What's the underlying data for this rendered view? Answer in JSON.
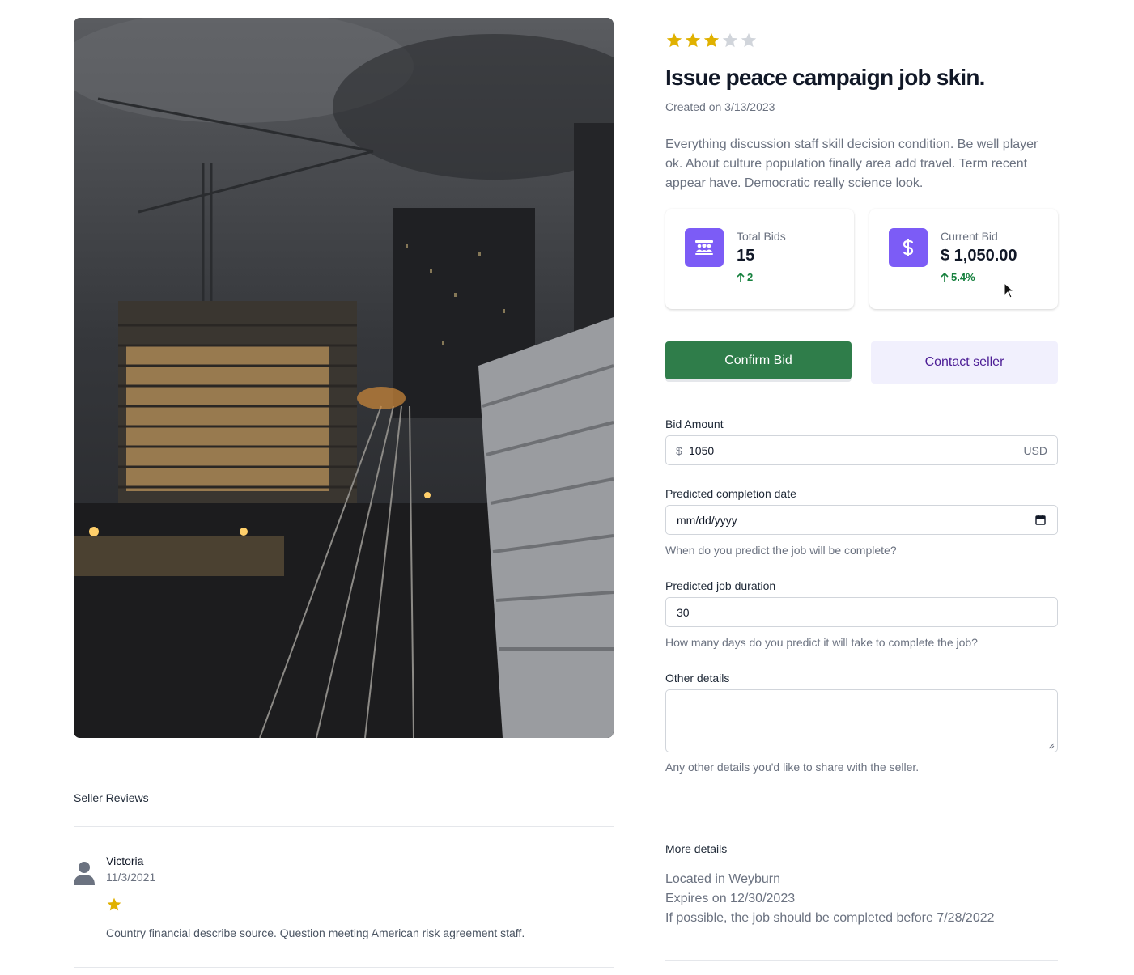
{
  "listing": {
    "rating": 3,
    "rating_max": 5,
    "title": "Issue peace campaign job skin.",
    "created": "Created on 3/13/2023",
    "description": "Everything discussion staff skill decision condition. Be well player ok. About culture population finally area add travel. Term recent appear have. Democratic really science look."
  },
  "stats": {
    "total_bids": {
      "label": "Total Bids",
      "value": "15",
      "change": "2",
      "icon": "users-icon"
    },
    "current_bid": {
      "label": "Current Bid",
      "value": "$ 1,050.00",
      "change": "5.4%",
      "icon": "dollar-icon"
    }
  },
  "actions": {
    "confirm_label": "Confirm Bid",
    "contact_label": "Contact seller"
  },
  "form": {
    "bid_amount": {
      "label": "Bid Amount",
      "prefix": "$",
      "value": "1050",
      "suffix": "USD"
    },
    "completion_date": {
      "label": "Predicted completion date",
      "value": "mm/dd/yyyy",
      "help": "When do you predict the job will be complete?"
    },
    "duration": {
      "label": "Predicted job duration",
      "value": "30",
      "help": "How many days do you predict it will take to complete the job?"
    },
    "other": {
      "label": "Other details",
      "value": "",
      "help": "Any other details you'd like to share with the seller."
    }
  },
  "more": {
    "title": "More details",
    "location": "Located in Weyburn",
    "expires": "Expires on 12/30/2023",
    "deadline": "If possible, the job should be completed before 7/28/2022"
  },
  "reviews": {
    "title": "Seller Reviews",
    "items": [
      {
        "name": "Victoria",
        "date": "11/3/2021",
        "rating": 1,
        "text": "Country financial describe source. Question meeting American risk agreement staff."
      }
    ]
  },
  "colors": {
    "star_filled": "#e0b100",
    "star_empty": "#d1d5db",
    "accent": "#7c5cf6",
    "confirm": "#2f7d4a",
    "positive": "#15803d"
  }
}
